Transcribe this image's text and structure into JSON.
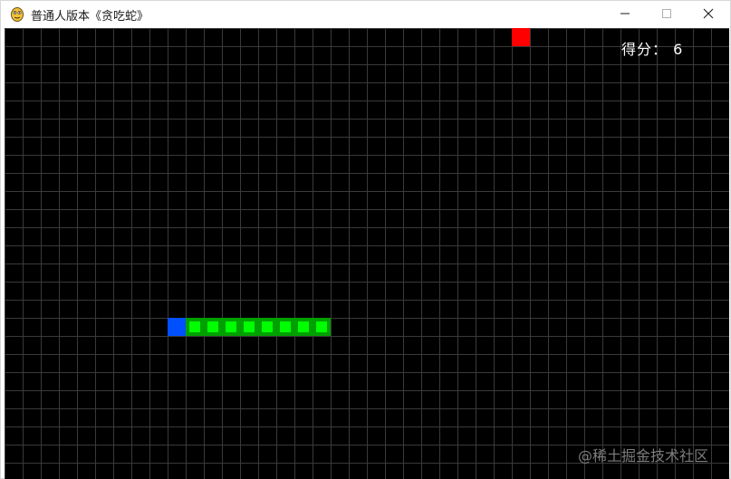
{
  "window": {
    "title": "普通人版本《贪吃蛇》",
    "app_icon": "pygame-snake-icon"
  },
  "game": {
    "score_label": "得分：",
    "score_value": 6,
    "score_text": "得分： 6",
    "food": {
      "col": 28,
      "row": 0
    },
    "snake": {
      "head": {
        "col": 9,
        "row": 16
      },
      "body": [
        {
          "col": 10,
          "row": 16
        },
        {
          "col": 11,
          "row": 16
        },
        {
          "col": 12,
          "row": 16
        },
        {
          "col": 13,
          "row": 16
        },
        {
          "col": 14,
          "row": 16
        },
        {
          "col": 15,
          "row": 16
        },
        {
          "col": 16,
          "row": 16
        },
        {
          "col": 17,
          "row": 16
        }
      ]
    },
    "colors": {
      "background": "#000000",
      "grid": "#3a3a3a",
      "food": "#ff0000",
      "head": "#0050ff",
      "body_outer": "#00a000",
      "body_inner": "#00ff00",
      "score_text": "#ffffff"
    }
  },
  "watermark": "@稀土掘金技术社区"
}
